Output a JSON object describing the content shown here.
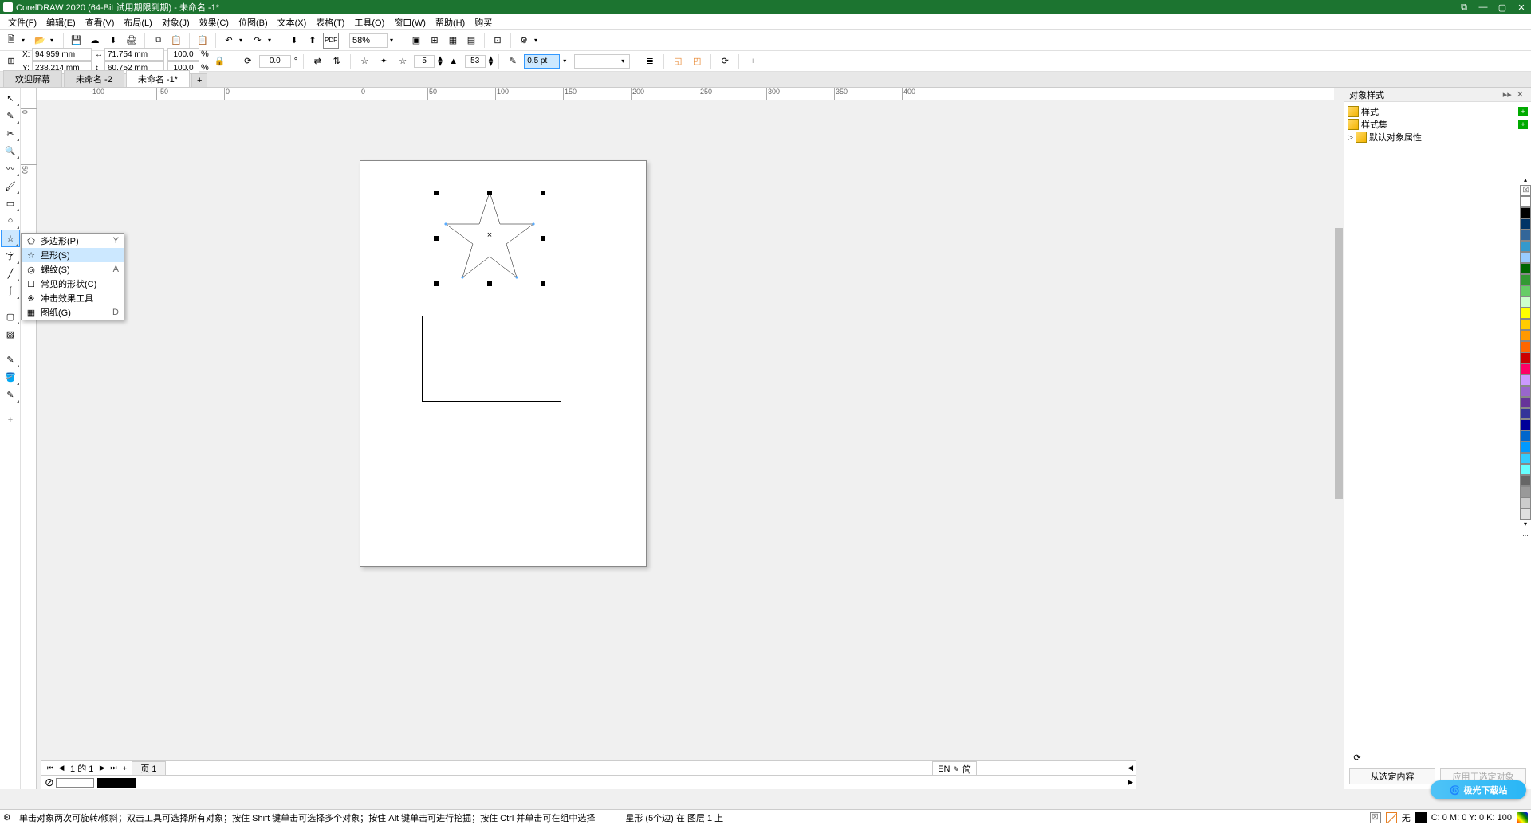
{
  "title": "CorelDRAW 2020 (64-Bit 试用期限到期) - 未命名 -1*",
  "menu": [
    "文件(F)",
    "编辑(E)",
    "查看(V)",
    "布局(L)",
    "对象(J)",
    "效果(C)",
    "位图(B)",
    "文本(X)",
    "表格(T)",
    "工具(O)",
    "窗口(W)",
    "帮助(H)",
    "购买"
  ],
  "zoom": "58%",
  "coords": {
    "x_label": "X:",
    "x": "94.959 mm",
    "y_label": "Y:",
    "y": "238.214 mm"
  },
  "size": {
    "w": "71.754 mm",
    "h": "60.752 mm",
    "sx": "100.0",
    "sy": "100.0",
    "pct": "%"
  },
  "rotation": "0.0",
  "deg_symbol": "°",
  "points": "5",
  "sharpness": "53",
  "outline_width": "0.5 pt",
  "doctabs": [
    {
      "label": "欢迎屏幕",
      "active": false
    },
    {
      "label": "未命名 -2",
      "active": false
    },
    {
      "label": "未命名 -1*",
      "active": true
    }
  ],
  "flyout": [
    {
      "icon": "⬠",
      "label": "多边形(P)",
      "key": "Y"
    },
    {
      "icon": "☆",
      "label": "星形(S)",
      "key": ""
    },
    {
      "icon": "◎",
      "label": "螺纹(S)",
      "key": "A"
    },
    {
      "icon": "☐",
      "label": "常见的形状(C)",
      "key": ""
    },
    {
      "icon": "※",
      "label": "冲击效果工具",
      "key": ""
    },
    {
      "icon": "▦",
      "label": "图纸(G)",
      "key": "D"
    }
  ],
  "docker": {
    "title": "对象样式",
    "tree": [
      {
        "icon": true,
        "label": "样式",
        "add": true
      },
      {
        "icon": true,
        "label": "样式集",
        "add": true
      },
      {
        "expand": "▷",
        "icon": true,
        "label": "默认对象属性"
      }
    ],
    "btn_from_sel": "从选定内容",
    "btn_apply": "应用于选定对象"
  },
  "ruler_h_ticks": [
    {
      "pos": 65,
      "v": "-100"
    },
    {
      "pos": 150,
      "v": "-50"
    },
    {
      "pos": 235,
      "v": "0"
    },
    {
      "pos": 405,
      "v": "0"
    },
    {
      "pos": 490,
      "v": "50"
    },
    {
      "pos": 575,
      "v": "100"
    },
    {
      "pos": 660,
      "v": "150"
    },
    {
      "pos": 745,
      "v": "200"
    },
    {
      "pos": 830,
      "v": "250"
    },
    {
      "pos": 915,
      "v": "300"
    },
    {
      "pos": 1000,
      "v": "350"
    },
    {
      "pos": 1085,
      "v": "400"
    }
  ],
  "ruler_v_ticks": [
    {
      "pos": 10,
      "v": "0"
    },
    {
      "pos": 80,
      "v": "50"
    }
  ],
  "colors": [
    "#ffffff",
    "#000000",
    "#003366",
    "#336699",
    "#3399cc",
    "#99ccff",
    "#006600",
    "#339933",
    "#66cc66",
    "#ccffcc",
    "#ffff00",
    "#ffcc00",
    "#ff9900",
    "#ff6600",
    "#cc0000",
    "#ff0066",
    "#cc99ff",
    "#9966cc",
    "#663399",
    "#333399",
    "#000099",
    "#0066cc",
    "#0099ff",
    "#33ccff",
    "#66ffff",
    "#666666",
    "#999999",
    "#cccccc",
    "#e0e0e0"
  ],
  "page": {
    "count": "1",
    "current": "1",
    "of": "的",
    "tab": "页 1",
    "plus": "+"
  },
  "lang": "EN",
  "lang2": "简",
  "foot_nocolor": "⊘",
  "status": {
    "msg": "单击对象两次可旋转/倾斜；双击工具可选择所有对象；按住 Shift 键单击可选择多个对象；按住 Alt 键单击可进行挖掘；按住 Ctrl 并单击可在组中选择",
    "selection": "星形 (5个边) 在 图层 1 上",
    "fill_none": "无",
    "cmyk": "C: 0 M: 0 Y: 0 K: 100"
  },
  "watermark": "极光下载站"
}
